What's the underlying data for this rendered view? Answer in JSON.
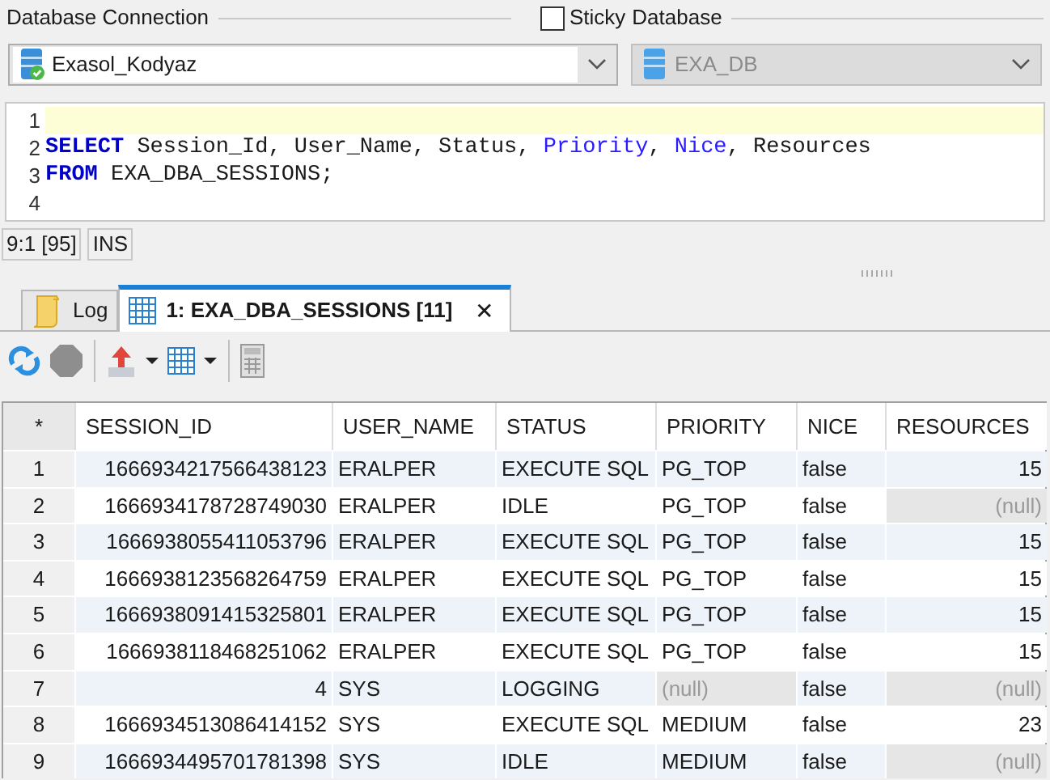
{
  "connection": {
    "label": "Database Connection",
    "value": "Exasol_Kodyaz"
  },
  "sticky": {
    "label": "Sticky",
    "checked": false
  },
  "database": {
    "label": "Database",
    "value": "EXA_DB",
    "disabled": true
  },
  "editor": {
    "lines": [
      {
        "number": "1",
        "current": true
      },
      {
        "number": "2",
        "current": false,
        "tokens": [
          {
            "text": "SELECT",
            "kind": "keyword"
          },
          {
            "text": " Session_Id, User_Name, Status, ",
            "kind": "plain"
          },
          {
            "text": "Priority",
            "kind": "reserved"
          },
          {
            "text": ", ",
            "kind": "plain"
          },
          {
            "text": "Nice",
            "kind": "reserved"
          },
          {
            "text": ", Resources",
            "kind": "plain"
          }
        ]
      },
      {
        "number": "3",
        "current": false,
        "tokens": [
          {
            "text": "FROM",
            "kind": "keyword"
          },
          {
            "text": " EXA_DBA_SESSIONS;",
            "kind": "plain"
          }
        ]
      },
      {
        "number": "4",
        "current": false
      }
    ]
  },
  "status_bar": [
    "9:1 [95]",
    "INS"
  ],
  "tabs": [
    {
      "label": "Log",
      "kind": "log",
      "selected": false,
      "closable": false
    },
    {
      "label": "1: EXA_DBA_SESSIONS [11]",
      "kind": "grid",
      "selected": true,
      "closable": true
    }
  ],
  "close_glyph": "✕",
  "table": {
    "corner": "*",
    "columns": [
      {
        "label": "SESSION_ID",
        "kind": "number"
      },
      {
        "label": "USER_NAME",
        "kind": "text"
      },
      {
        "label": "STATUS",
        "kind": "text"
      },
      {
        "label": "PRIORITY",
        "kind": "text"
      },
      {
        "label": "NICE",
        "kind": "text"
      },
      {
        "label": "RESOURCES",
        "kind": "number"
      }
    ],
    "rows": [
      {
        "number": "1",
        "cells": [
          {
            "text": "1666934217566438123",
            "null": false
          },
          {
            "text": "ERALPER",
            "null": false
          },
          {
            "text": "EXECUTE SQL",
            "null": false
          },
          {
            "text": "PG_TOP",
            "null": false
          },
          {
            "text": "false",
            "null": false
          },
          {
            "text": "15",
            "null": false
          }
        ]
      },
      {
        "number": "2",
        "cells": [
          {
            "text": "1666934178728749030",
            "null": false
          },
          {
            "text": "ERALPER",
            "null": false
          },
          {
            "text": "IDLE",
            "null": false
          },
          {
            "text": "PG_TOP",
            "null": false
          },
          {
            "text": "false",
            "null": false
          },
          {
            "text": "(null)",
            "null": true
          }
        ]
      },
      {
        "number": "3",
        "cells": [
          {
            "text": "1666938055411053796",
            "null": false
          },
          {
            "text": "ERALPER",
            "null": false
          },
          {
            "text": "EXECUTE SQL",
            "null": false
          },
          {
            "text": "PG_TOP",
            "null": false
          },
          {
            "text": "false",
            "null": false
          },
          {
            "text": "15",
            "null": false
          }
        ]
      },
      {
        "number": "4",
        "cells": [
          {
            "text": "1666938123568264759",
            "null": false
          },
          {
            "text": "ERALPER",
            "null": false
          },
          {
            "text": "EXECUTE SQL",
            "null": false
          },
          {
            "text": "PG_TOP",
            "null": false
          },
          {
            "text": "false",
            "null": false
          },
          {
            "text": "15",
            "null": false
          }
        ]
      },
      {
        "number": "5",
        "cells": [
          {
            "text": "1666938091415325801",
            "null": false
          },
          {
            "text": "ERALPER",
            "null": false
          },
          {
            "text": "EXECUTE SQL",
            "null": false
          },
          {
            "text": "PG_TOP",
            "null": false
          },
          {
            "text": "false",
            "null": false
          },
          {
            "text": "15",
            "null": false
          }
        ]
      },
      {
        "number": "6",
        "cells": [
          {
            "text": "1666938118468251062",
            "null": false
          },
          {
            "text": "ERALPER",
            "null": false
          },
          {
            "text": "EXECUTE SQL",
            "null": false
          },
          {
            "text": "PG_TOP",
            "null": false
          },
          {
            "text": "false",
            "null": false
          },
          {
            "text": "15",
            "null": false
          }
        ]
      },
      {
        "number": "7",
        "cells": [
          {
            "text": "4",
            "null": false
          },
          {
            "text": "SYS",
            "null": false
          },
          {
            "text": "LOGGING",
            "null": false
          },
          {
            "text": "(null)",
            "null": true
          },
          {
            "text": "false",
            "null": false
          },
          {
            "text": "(null)",
            "null": true
          }
        ]
      },
      {
        "number": "8",
        "cells": [
          {
            "text": "1666934513086414152",
            "null": false
          },
          {
            "text": "SYS",
            "null": false
          },
          {
            "text": "EXECUTE SQL",
            "null": false
          },
          {
            "text": "MEDIUM",
            "null": false
          },
          {
            "text": "false",
            "null": false
          },
          {
            "text": "23",
            "null": false
          }
        ]
      },
      {
        "number": "9",
        "cells": [
          {
            "text": "1666934495701781398",
            "null": false
          },
          {
            "text": "SYS",
            "null": false
          },
          {
            "text": "IDLE",
            "null": false
          },
          {
            "text": "MEDIUM",
            "null": false
          },
          {
            "text": "false",
            "null": false
          },
          {
            "text": "(null)",
            "null": true
          }
        ]
      }
    ]
  }
}
